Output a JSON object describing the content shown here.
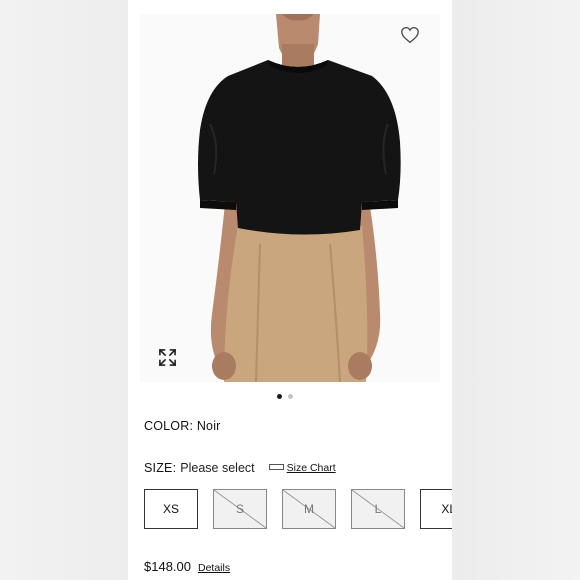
{
  "product": {
    "image_alt": "Black puff-sleeve sweater worn with camel skirt",
    "color_label": "COLOR:",
    "color_value": "Noir",
    "size_label": "SIZE:",
    "size_prompt": "Please select",
    "size_chart_link": "Size Chart",
    "sizes": [
      {
        "label": "XS",
        "available": true
      },
      {
        "label": "S",
        "available": false
      },
      {
        "label": "M",
        "available": false
      },
      {
        "label": "L",
        "available": false
      },
      {
        "label": "XL",
        "available": true
      }
    ],
    "price": "$148.00",
    "details_link": "Details"
  },
  "carousel": {
    "count": 2,
    "active_index": 1
  },
  "icons": {
    "wishlist": "heart-outline-icon",
    "expand": "expand-arrows-icon",
    "size_chart": "ruler-icon"
  },
  "colors": {
    "garment_top": "#141414",
    "garment_skirt": "#c9a67e",
    "skin": "#b98a6d",
    "unavailable_bg": "#f1f1f1"
  }
}
